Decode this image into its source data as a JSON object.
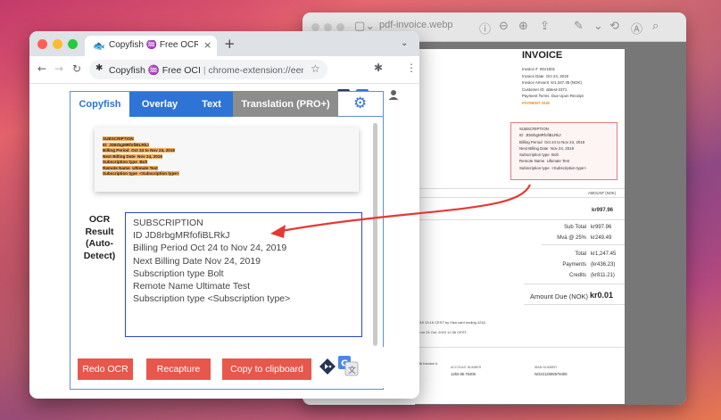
{
  "preview": {
    "title": "pdf-invoice.webp",
    "invoice": {
      "title": "INVOICE",
      "meta_lines": [
        "Invoice #  INV1001",
        "Invoice Date  Oct 24, 2019",
        "Invoice Amount  kr1,347.45 (NOK)",
        "Customer ID  abtest-2371",
        "Payment Terms  Due Upon Receipt"
      ],
      "status": "PAYMENT DUE",
      "subscription_lines": [
        "SUBSCRIPTION",
        "ID  JD8rbgMRfofiBLRkJ",
        "Billing Period  Oct 24 to Nov 24, 2019",
        "Next Billing Date  Nov 24, 2019",
        "Subscription type  Bolt",
        "Remote Name  Ultimate Test",
        "Subscription type  <Subscription type>"
      ],
      "amount_header": "AMOUNT (NOK)",
      "first_amount": "kr997.96",
      "totals": [
        {
          "label": "Sub Total",
          "value": "kr997.96"
        },
        {
          "label": "Mvá @ 25%",
          "value": "kr249.49"
        },
        {
          "label": "Total",
          "value": "kr1,247.45"
        },
        {
          "label": "Payments",
          "value": "(kr436.23)"
        },
        {
          "label": "Credits",
          "value": "(kr811.21)"
        }
      ],
      "amount_due_label": "Amount Due (NOK)",
      "amount_due_value": "kr0.01",
      "note_1": "2019 13:16 CEST by Visa card ending 4242.",
      "note_2": "ed on 24 Oct, 2019 12:36 CEST.",
      "note_3": "with Invoice #",
      "pay_headers": [
        "ACCOUNT NUMBER",
        "IBAN NUMBER"
      ],
      "pay_values": [
        "1250.85.78406",
        "NO2212508578406"
      ]
    }
  },
  "browser": {
    "tab_title": "Copyfish ♒ Free OCR Softwa",
    "omnibox_title": "Copyfish ♒ Free OCI",
    "omnibox_sep": "|",
    "omnibox_url": "chrome-extension://eenjdn...",
    "new_tab": "+",
    "tab_close": "×"
  },
  "copyfish": {
    "tabs": [
      "Copyfish",
      "Overlay",
      "Text",
      "Translation (PRO+)"
    ],
    "captured_lines": [
      "SUBSCRIPTION",
      "ID  JD8rbgMRfofiBLRkJ",
      "Billing Period  Oct 24 to Nov 24, 2019",
      "Next Billing Date  Nov 24, 2019",
      "Subscription type  Bolt",
      "Remote Name  Ultimate Test",
      "Subscription type  <Subscription type>"
    ],
    "ocr_label": "OCR\nResult\n(Auto-\nDetect)",
    "ocr_text": "SUBSCRIPTION\nID JD8rbgMRfofiBLRkJ\nBilling Period Oct 24 to Nov 24, 2019\nNext Billing Date Nov 24, 2019\nSubscription type Bolt\nRemote Name Ultimate Test\nSubscription type <Subscription type>",
    "buttons": {
      "redo": "Redo OCR",
      "recapture": "Recapture",
      "copy": "Copy to clipboard"
    }
  },
  "colors": {
    "accent_blue": "#2d74d6",
    "button_red": "#e8574b",
    "arrow_red": "#e53935"
  },
  "icons": [
    "copyfish-favicon",
    "gear-icon",
    "speak-icon",
    "translate-icon",
    "star-icon",
    "puzzle-icon",
    "profile-icon"
  ]
}
